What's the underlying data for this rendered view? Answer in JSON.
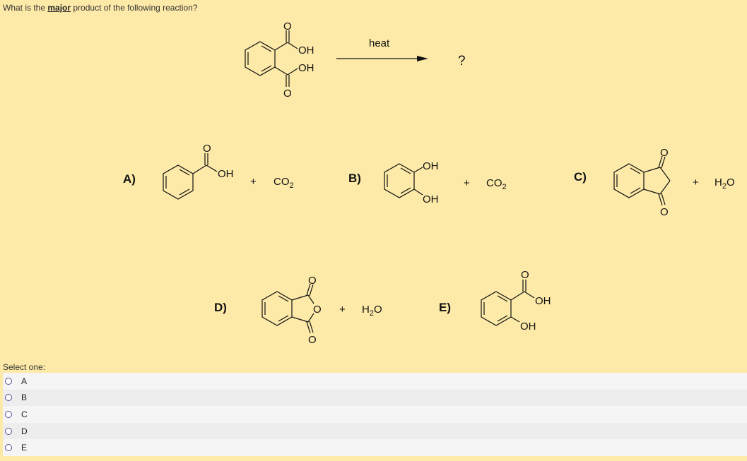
{
  "question": {
    "prefix": "What is the ",
    "emphasis": "major",
    "suffix": " product of the following reaction?"
  },
  "reaction": {
    "reactant": "phthalic acid (benzene-1,2-dicarboxylic acid)",
    "reactant_labels": {
      "o_top": "O",
      "oh_top": "OH",
      "oh_bottom": "OH",
      "o_bottom": "O"
    },
    "condition": "heat",
    "product": "?"
  },
  "answers": [
    {
      "letter": "A)",
      "structure": "benzoic acid",
      "atom_labels": {
        "o": "O",
        "oh": "OH"
      },
      "plus": "+",
      "byproduct": {
        "main": "CO",
        "sub": "2"
      }
    },
    {
      "letter": "B)",
      "structure": "catechol (benzene-1,2-diol)",
      "atom_labels": {
        "oh_top": "OH",
        "oh_bottom": "OH"
      },
      "plus": "+",
      "byproduct": {
        "main": "CO",
        "sub": "2"
      }
    },
    {
      "letter": "C)",
      "structure": "indane-1,3-dione",
      "atom_labels": {
        "o_top": "O",
        "o_bottom": "O"
      },
      "plus": "+",
      "byproduct": {
        "pre": "H",
        "sub": "2",
        "post": "O"
      }
    },
    {
      "letter": "D)",
      "structure": "phthalic anhydride",
      "atom_labels": {
        "o_top": "O",
        "o_ring": "O",
        "o_bottom": "O"
      },
      "plus": "+",
      "byproduct": {
        "pre": "H",
        "sub": "2",
        "post": "O"
      }
    },
    {
      "letter": "E)",
      "structure": "salicylic acid",
      "atom_labels": {
        "o": "O",
        "oh_acid": "OH",
        "oh_phenol": "OH"
      }
    }
  ],
  "select_prompt": "Select one:",
  "options": [
    {
      "label": "A",
      "selected": false
    },
    {
      "label": "B",
      "selected": false
    },
    {
      "label": "C",
      "selected": false
    },
    {
      "label": "D",
      "selected": false
    },
    {
      "label": "E",
      "selected": false
    }
  ]
}
